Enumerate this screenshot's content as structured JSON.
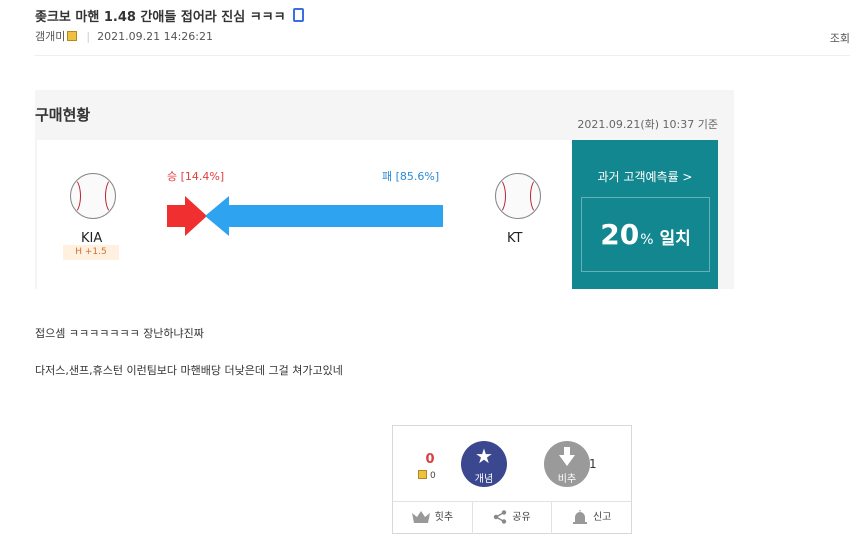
{
  "post": {
    "title": "좆크보 마핸 1.48 간애들 접어라 진심 ㅋㅋㅋ",
    "author": "갬개미",
    "datetime": "2021.09.21 14:26:21",
    "view_label": "조회"
  },
  "embed": {
    "title": "구매현황",
    "date": "2021.09.21(화) 10:37 기준",
    "home_team": "KIA",
    "home_handicap": "H +1.5",
    "away_team": "KT",
    "win_label": "승 [14.4%]",
    "lose_label": "패 [85.6%]",
    "win_pct": 14.4,
    "lose_pct": 85.6,
    "history_label": "과거 고객예측률 >",
    "history_value": "20",
    "history_unit": "%",
    "history_suffix": "일치",
    "colors": {
      "win": "#f03030",
      "lose": "#2ea4f0",
      "panel": "#13878f"
    }
  },
  "body": {
    "line1": "접으셈 ㅋㅋㅋㅋㅋㅋㅋ 장난하냐진짜",
    "line2": "다저스,샌프,휴스턴 이런팀보다 마핸배당 더낮은데 그걸 쳐가고있네"
  },
  "vote": {
    "up_count": "0",
    "fix_count": "0",
    "up_label": "개념",
    "down_label": "비추",
    "down_count": "1",
    "footer": [
      "힛추",
      "공유",
      "신고"
    ],
    "colors": {
      "up": "#3b4890",
      "down": "#9a9a9a",
      "up_count": "#d84040"
    }
  }
}
